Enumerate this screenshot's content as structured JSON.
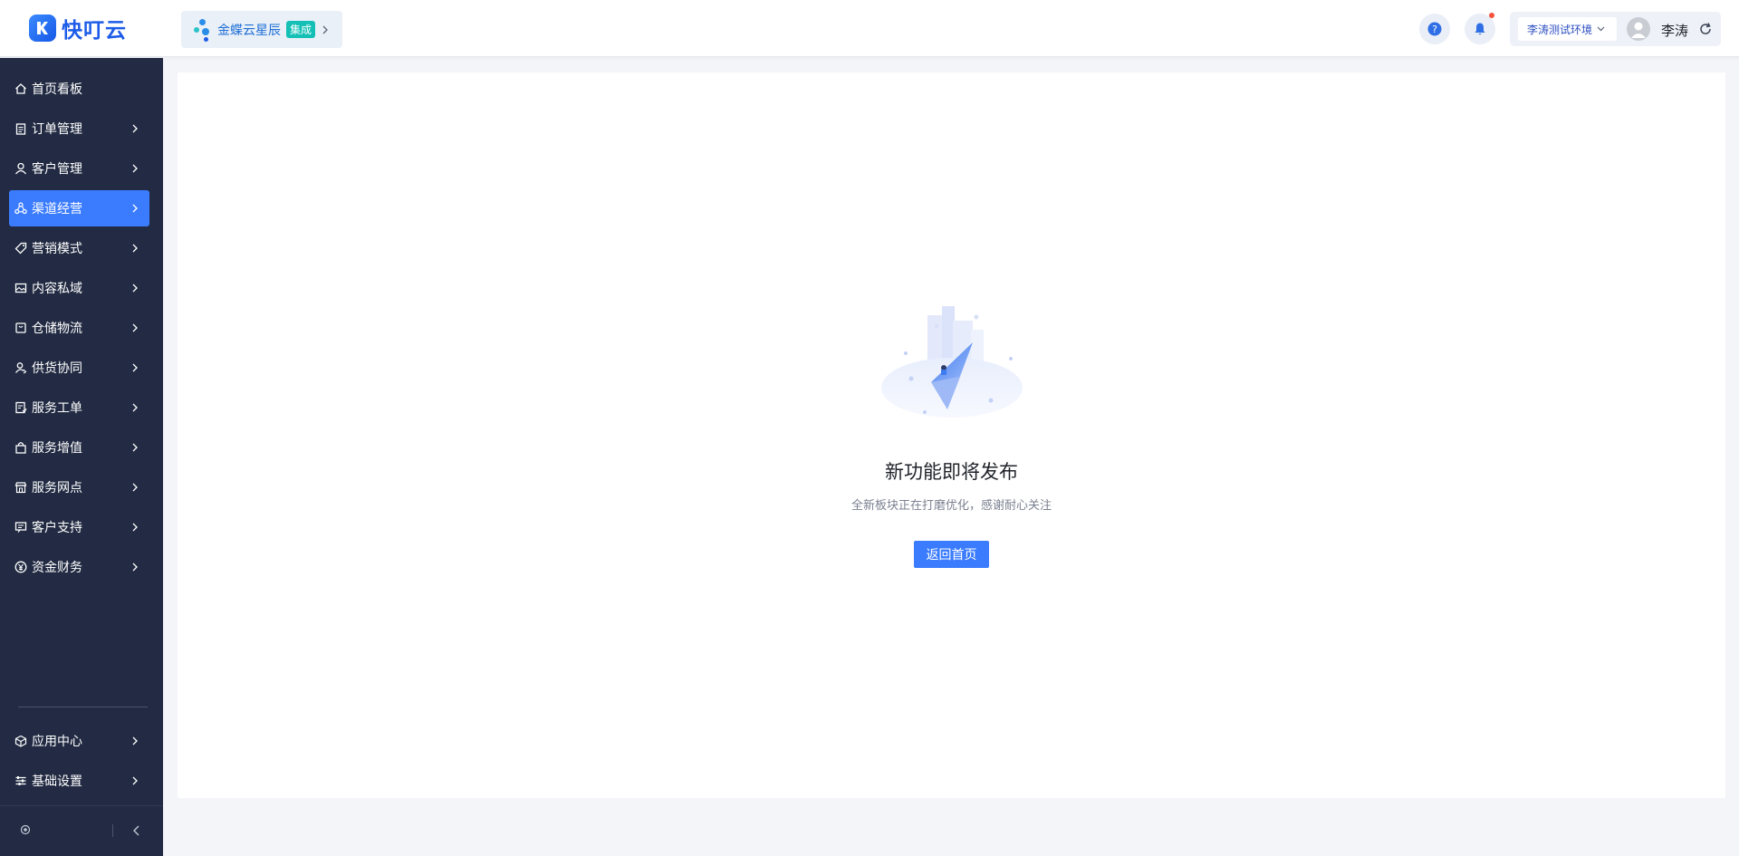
{
  "app": {
    "logo_text": "快叮云"
  },
  "integration": {
    "name": "金蝶云星辰",
    "tag": "集成"
  },
  "header": {
    "env_label": "李涛测试环境",
    "user_name": "李涛"
  },
  "sidebar": {
    "items": [
      {
        "label": "首页看板",
        "icon": "home-icon",
        "has_arrow": false,
        "active": false
      },
      {
        "label": "订单管理",
        "icon": "clipboard-icon",
        "has_arrow": true,
        "active": false
      },
      {
        "label": "客户管理",
        "icon": "user-icon",
        "has_arrow": true,
        "active": false
      },
      {
        "label": "渠道经营",
        "icon": "network-icon",
        "has_arrow": true,
        "active": true
      },
      {
        "label": "营销模式",
        "icon": "tag-icon",
        "has_arrow": true,
        "active": false
      },
      {
        "label": "内容私域",
        "icon": "image-icon",
        "has_arrow": true,
        "active": false
      },
      {
        "label": "仓储物流",
        "icon": "box-icon",
        "has_arrow": true,
        "active": false
      },
      {
        "label": "供货协同",
        "icon": "user-switch-icon",
        "has_arrow": true,
        "active": false
      },
      {
        "label": "服务工单",
        "icon": "ticket-icon",
        "has_arrow": true,
        "active": false
      },
      {
        "label": "服务增值",
        "icon": "bag-icon",
        "has_arrow": true,
        "active": false
      },
      {
        "label": "服务网点",
        "icon": "store-icon",
        "has_arrow": true,
        "active": false
      },
      {
        "label": "客户支持",
        "icon": "message-icon",
        "has_arrow": true,
        "active": false
      },
      {
        "label": "资金财务",
        "icon": "yuan-icon",
        "has_arrow": true,
        "active": false
      }
    ],
    "bottom_items": [
      {
        "label": "应用中心",
        "icon": "cube-icon",
        "has_arrow": true
      },
      {
        "label": "基础设置",
        "icon": "sliders-icon",
        "has_arrow": true
      }
    ]
  },
  "main": {
    "title": "新功能即将发布",
    "subtitle": "全新板块正在打磨优化，感谢耐心关注",
    "button_label": "返回首页"
  },
  "colors": {
    "accent": "#3b7cff",
    "sidebar_bg": "#222b43",
    "tag_teal": "#14c0b5",
    "notify_red": "#f5533d"
  }
}
